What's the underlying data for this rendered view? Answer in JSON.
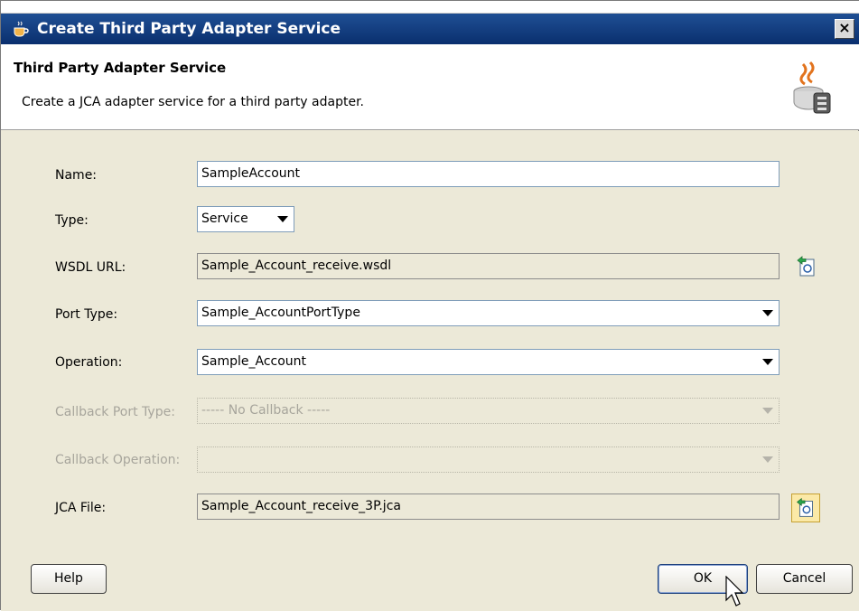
{
  "window": {
    "title": "Create Third Party Adapter Service",
    "close_glyph": "×"
  },
  "header": {
    "title": "Third Party Adapter Service",
    "description": "Create a JCA adapter service for a third party adapter.",
    "icon": "java-adapter-icon"
  },
  "form": {
    "name": {
      "label": "Name:",
      "value": "SampleAccount"
    },
    "type": {
      "label": "Type:",
      "value": "Service"
    },
    "wsdl_url": {
      "label": "WSDL URL:",
      "value": "Sample_Account_receive.wsdl",
      "browse_icon": "browse-wsdl-icon"
    },
    "port_type": {
      "label": "Port Type:",
      "value": "Sample_AccountPortType"
    },
    "operation": {
      "label": "Operation:",
      "value": "Sample_Account"
    },
    "callback_port_type": {
      "label": "Callback Port Type:",
      "value": "----- No Callback -----"
    },
    "callback_operation": {
      "label": "Callback Operation:",
      "value": ""
    },
    "jca_file": {
      "label": "JCA File:",
      "value": "Sample_Account_receive_3P.jca",
      "browse_icon": "browse-jca-icon"
    }
  },
  "buttons": {
    "help": "Help",
    "ok": "OK",
    "cancel": "Cancel"
  },
  "colors": {
    "titlebar": "#0a2f6e",
    "dialog_bg": "#ece9d8",
    "field_border": "#7f9db9",
    "disabled_text": "#a7a59c"
  }
}
